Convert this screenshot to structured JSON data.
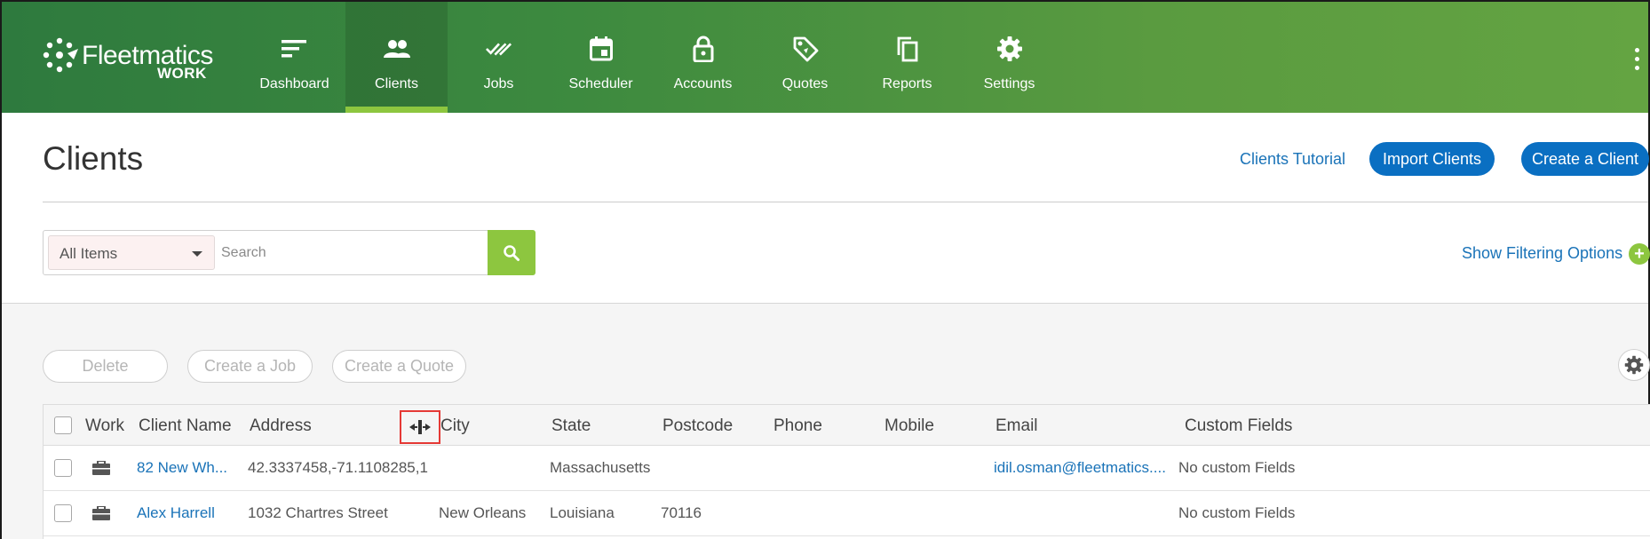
{
  "app": {
    "logo_text": "Fleetmatics",
    "logo_sub": "WORK"
  },
  "nav": {
    "items": [
      {
        "label": "Dashboard",
        "icon": "dashboard-icon"
      },
      {
        "label": "Clients",
        "icon": "clients-icon",
        "active": true
      },
      {
        "label": "Jobs",
        "icon": "jobs-icon"
      },
      {
        "label": "Scheduler",
        "icon": "calendar-icon"
      },
      {
        "label": "Accounts",
        "icon": "lock-icon"
      },
      {
        "label": "Quotes",
        "icon": "tag-icon"
      },
      {
        "label": "Reports",
        "icon": "copy-icon"
      },
      {
        "label": "Settings",
        "icon": "gear-icon"
      }
    ]
  },
  "header": {
    "title": "Clients",
    "tutorial_link": "Clients Tutorial",
    "import_button": "Import Clients",
    "create_button": "Create a Client"
  },
  "search": {
    "filter_selected": "All Items",
    "placeholder": "Search",
    "value": "",
    "filter_link": "Show Filtering Options",
    "filter_plus": "+"
  },
  "actions": {
    "delete": "Delete",
    "create_job": "Create a Job",
    "create_quote": "Create a Quote"
  },
  "table": {
    "columns": [
      "Work",
      "Client Name",
      "Address",
      "City",
      "State",
      "Postcode",
      "Phone",
      "Mobile",
      "Email",
      "Custom Fields"
    ],
    "rows": [
      {
        "client_name": "82 New Wh...",
        "address": "42.3337458,-71.1108285,1",
        "city": "",
        "state": "Massachusetts",
        "postcode": "",
        "phone": "",
        "mobile": "",
        "email": "idil.osman@fleetmatics....",
        "custom_fields": "No custom Fields"
      },
      {
        "client_name": "Alex Harrell",
        "address": "1032 Chartres Street",
        "city": "New Orleans",
        "state": "Louisiana",
        "postcode": "70116",
        "phone": "",
        "mobile": "",
        "email": "",
        "custom_fields": "No custom Fields"
      }
    ]
  },
  "colors": {
    "nav_gradient_start": "#2e7a3e",
    "nav_gradient_end": "#64a442",
    "active_underline": "#8dc63f",
    "primary_button": "#0a6fc2",
    "link": "#1a73b8",
    "search_button": "#8dc63f",
    "highlight_box": "#e53935"
  }
}
